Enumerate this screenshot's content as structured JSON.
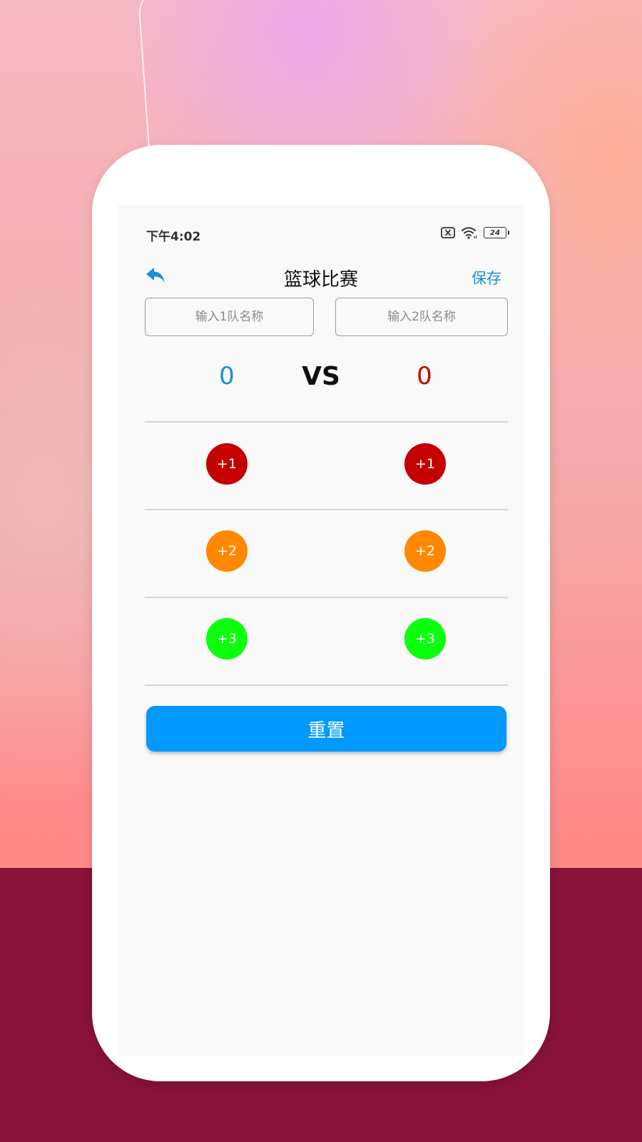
{
  "status_bar": {
    "time": "下午4:02",
    "battery": "24",
    "icons": [
      "sim-off-icon",
      "wifi-icon",
      "battery-icon"
    ]
  },
  "toolbar": {
    "back_icon": "back-arrow-icon",
    "title": "篮球比赛",
    "save_label": "保存"
  },
  "inputs": {
    "team1_placeholder": "输入1队名称",
    "team2_placeholder": "输入2队名称",
    "team1_value": "",
    "team2_value": ""
  },
  "scoreboard": {
    "team1_score": "0",
    "vs_label": "VS",
    "team2_score": "0"
  },
  "score_buttons": {
    "plus1": "+1",
    "plus2": "+2",
    "plus3": "+3"
  },
  "reset_label": "重置",
  "colors": {
    "accent": "#1a8fd6",
    "reset_button": "#0099ff",
    "plus1": "#c40000",
    "plus2": "#ff8800",
    "plus3": "#0cff0c",
    "team2_score": "#c40000",
    "background_band": "#88123a"
  }
}
